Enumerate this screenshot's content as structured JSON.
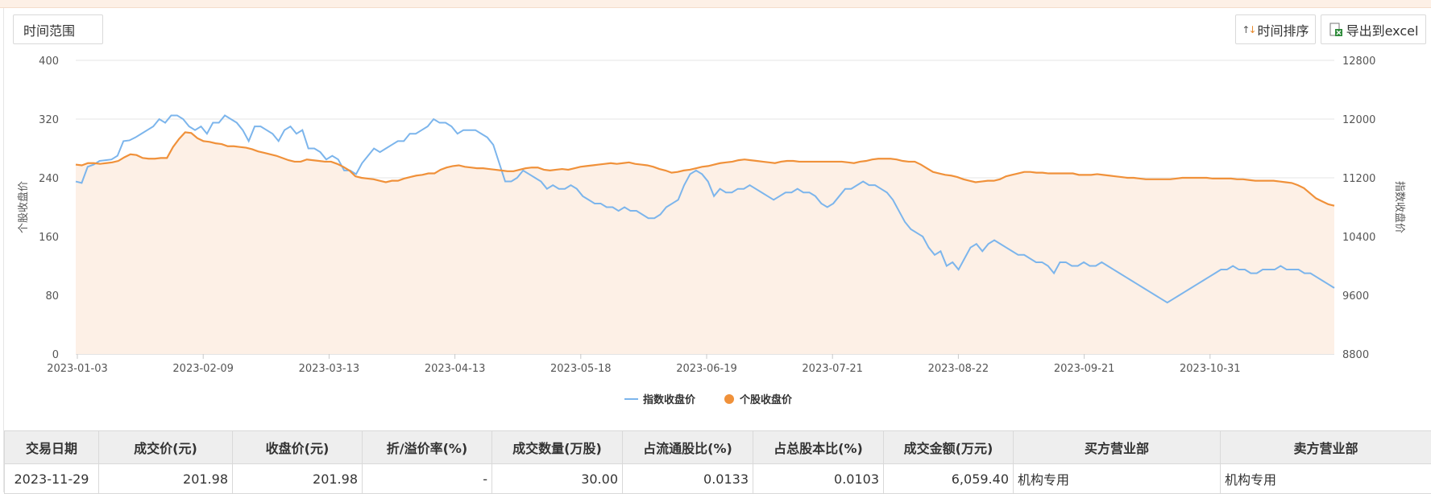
{
  "toolbar": {
    "time_range_label": "时间范围",
    "sort_label": "时间排序",
    "export_label": "导出到excel"
  },
  "chart_data": {
    "type": "line",
    "x_tick_labels": [
      "2023-01-03",
      "2023-02-09",
      "2023-03-13",
      "2023-04-13",
      "2023-05-18",
      "2023-06-19",
      "2023-07-21",
      "2023-08-22",
      "2023-09-21",
      "2023-10-31"
    ],
    "y_left": {
      "label": "个股收盘价",
      "ticks": [
        0,
        80,
        160,
        240,
        320,
        400
      ],
      "range": [
        0,
        400
      ]
    },
    "y_right": {
      "label": "指数收盘价",
      "ticks": [
        8800,
        9600,
        10400,
        11200,
        12000,
        12800
      ],
      "range": [
        8800,
        12800
      ]
    },
    "legend": [
      "指数收盘价",
      "个股收盘价"
    ],
    "legend_position": "bottom",
    "grid": true,
    "series": [
      {
        "name": "指数收盘价",
        "axis": "right",
        "color": "#7cb5ec",
        "values": [
          11150,
          11130,
          11350,
          11380,
          11430,
          11440,
          11450,
          11500,
          11700,
          11710,
          11750,
          11800,
          11850,
          11900,
          12000,
          11950,
          12050,
          12050,
          12000,
          11900,
          11850,
          11900,
          11800,
          11950,
          11950,
          12050,
          12000,
          11950,
          11850,
          11700,
          11900,
          11900,
          11850,
          11800,
          11700,
          11850,
          11900,
          11800,
          11850,
          11600,
          11600,
          11550,
          11450,
          11500,
          11450,
          11300,
          11300,
          11250,
          11400,
          11500,
          11600,
          11550,
          11600,
          11650,
          11700,
          11700,
          11800,
          11800,
          11850,
          11900,
          12000,
          11950,
          11950,
          11900,
          11800,
          11850,
          11850,
          11850,
          11800,
          11750,
          11650,
          11400,
          11150,
          11150,
          11200,
          11300,
          11250,
          11200,
          11150,
          11050,
          11100,
          11050,
          11050,
          11100,
          11050,
          10950,
          10900,
          10850,
          10850,
          10800,
          10800,
          10750,
          10800,
          10750,
          10750,
          10700,
          10650,
          10650,
          10700,
          10800,
          10850,
          10900,
          11100,
          11250,
          11300,
          11250,
          11150,
          10950,
          11050,
          11000,
          11000,
          11050,
          11050,
          11100,
          11050,
          11000,
          10950,
          10900,
          10950,
          11000,
          11000,
          11050,
          11000,
          11000,
          10950,
          10850,
          10800,
          10850,
          10950,
          11050,
          11050,
          11100,
          11150,
          11100,
          11100,
          11050,
          11000,
          10900,
          10750,
          10600,
          10500,
          10450,
          10400,
          10250,
          10150,
          10200,
          10000,
          10050,
          9950,
          10100,
          10250,
          10300,
          10200,
          10300,
          10350,
          10300,
          10250,
          10200,
          10150,
          10150,
          10100,
          10050,
          10050,
          10000,
          9900,
          10050,
          10050,
          10000,
          10000,
          10050,
          10000,
          10000,
          10050,
          10000,
          9950,
          9900,
          9850,
          9800,
          9750,
          9700,
          9650,
          9600,
          9550,
          9500,
          9550,
          9600,
          9650,
          9700,
          9750,
          9800,
          9850,
          9900,
          9950,
          9950,
          10000,
          9950,
          9950,
          9900,
          9900,
          9950,
          9950,
          9950,
          10000,
          9950,
          9950,
          9950,
          9900,
          9900,
          9850,
          9800,
          9750,
          9700
        ]
      },
      {
        "name": "个股收盘价",
        "axis": "left",
        "color": "#f0913a",
        "values": [
          258,
          257,
          260,
          260,
          259,
          260,
          261,
          263,
          268,
          272,
          271,
          267,
          266,
          266,
          267,
          267,
          282,
          293,
          302,
          301,
          294,
          290,
          289,
          287,
          286,
          283,
          283,
          282,
          281,
          279,
          276,
          274,
          272,
          270,
          267,
          264,
          262,
          262,
          265,
          264,
          263,
          262,
          262,
          259,
          255,
          250,
          242,
          240,
          239,
          238,
          236,
          234,
          236,
          236,
          239,
          241,
          243,
          244,
          246,
          246,
          251,
          254,
          256,
          257,
          255,
          254,
          253,
          253,
          252,
          251,
          250,
          249,
          249,
          251,
          253,
          254,
          254,
          251,
          250,
          251,
          252,
          251,
          253,
          255,
          256,
          257,
          258,
          259,
          260,
          259,
          260,
          261,
          259,
          258,
          257,
          255,
          252,
          250,
          247,
          248,
          250,
          251,
          253,
          255,
          256,
          258,
          260,
          261,
          262,
          264,
          265,
          264,
          263,
          262,
          261,
          260,
          262,
          263,
          263,
          262,
          262,
          262,
          262,
          262,
          262,
          262,
          262,
          261,
          260,
          262,
          263,
          265,
          266,
          266,
          266,
          265,
          263,
          262,
          262,
          258,
          253,
          248,
          246,
          244,
          243,
          241,
          238,
          236,
          234,
          235,
          236,
          236,
          238,
          242,
          244,
          246,
          248,
          248,
          247,
          247,
          246,
          246,
          246,
          246,
          246,
          244,
          244,
          244,
          245,
          244,
          243,
          242,
          241,
          240,
          240,
          239,
          238,
          238,
          238,
          238,
          238,
          239,
          240,
          240,
          240,
          240,
          240,
          239,
          239,
          239,
          239,
          238,
          238,
          237,
          236,
          236,
          236,
          236,
          235,
          234,
          233,
          230,
          226,
          219,
          212,
          208,
          204,
          202
        ]
      }
    ]
  },
  "table": {
    "headers": [
      "交易日期",
      "成交价(元)",
      "收盘价(元)",
      "折/溢价率(%)",
      "成交数量(万股)",
      "占流通股比(%)",
      "占总股本比(%)",
      "成交金额(万元)",
      "买方营业部",
      "卖方营业部"
    ],
    "rows": [
      [
        "2023-11-29",
        "201.98",
        "201.98",
        "-",
        "30.00",
        "0.0133",
        "0.0103",
        "6,059.40",
        "机构专用",
        "机构专用"
      ]
    ]
  }
}
